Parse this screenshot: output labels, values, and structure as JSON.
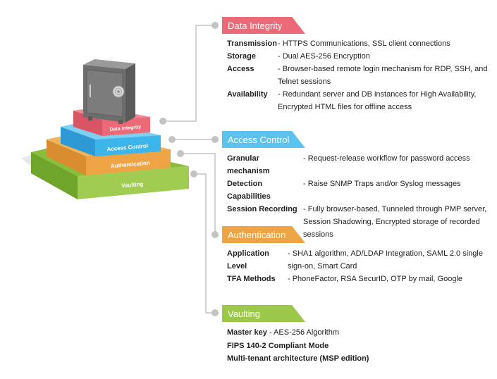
{
  "colors": {
    "data_integrity": "#ec6a78",
    "access_control": "#5cc2ee",
    "authentication": "#eea444",
    "vaulting": "#9cc84a",
    "connector": "#c4c4c4",
    "safe": "#7a7a7a"
  },
  "pyramid": {
    "safe_icon": "safe-icon",
    "layers": [
      {
        "label": "Data Integrity"
      },
      {
        "label": "Access Control"
      },
      {
        "label": "Authentication"
      },
      {
        "label": "Vaulting"
      }
    ]
  },
  "sections": {
    "data_integrity": {
      "title": "Data Integrity",
      "rows": [
        {
          "key": "Transmission",
          "value": "- HTTPS Communications, SSL client connections"
        },
        {
          "key": "Storage",
          "value": "- Dual AES-256 Encryption"
        },
        {
          "key": "Access",
          "value": "- Browser-based remote login mechanism for RDP, SSH, and Telnet sessions"
        },
        {
          "key": "Availability",
          "value": "- Redundant server and DB instances for High Availability, Encrypted HTML files for offline access"
        }
      ]
    },
    "access_control": {
      "title": "Access Control",
      "rows": [
        {
          "key": "Granular mechanism",
          "value": "- Request-release workflow for password access"
        },
        {
          "key": "Detection Capabilities",
          "value": "- Raise SNMP Traps and/or Syslog messages"
        },
        {
          "key": "Session Recording",
          "value": "- Fully browser-based, Tunneled through PMP server, Session Shadowing, Encrypted storage of recorded sessions"
        }
      ]
    },
    "authentication": {
      "title": "Authentication",
      "rows": [
        {
          "key": "Application Level",
          "value": "- SHA1 algorithm, AD/LDAP Integration, SAML 2.0 single sign-on, Smart Card"
        },
        {
          "key": "TFA Methods",
          "value": "- PhoneFactor, RSA SecurID, OTP by mail, Google"
        }
      ]
    },
    "vaulting": {
      "title": "Vaulting",
      "lines": [
        {
          "key": "Master key",
          "value": " - AES-256 Algorithm"
        },
        {
          "key": "FIPS 140-2 Compliant Mode",
          "value": ""
        },
        {
          "key": "Multi-tenant architecture (MSP edition)",
          "value": ""
        }
      ]
    }
  }
}
